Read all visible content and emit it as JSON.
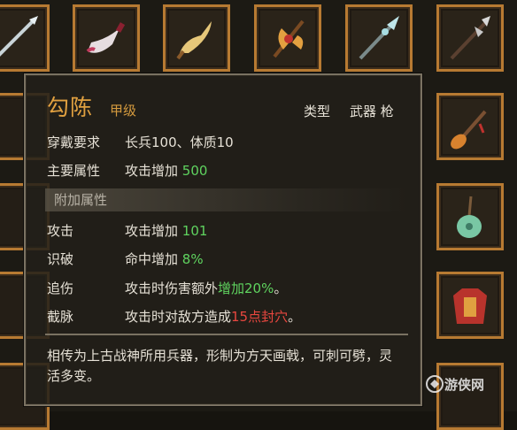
{
  "item": {
    "name": "勾陈",
    "grade": "甲级",
    "type_label": "类型",
    "type_value": "武器 枪",
    "requirement_label": "穿戴要求",
    "requirement_value": "长兵100、体质10",
    "main_attr_label": "主要属性",
    "main_attr_text": "攻击增加",
    "main_attr_value": "500",
    "extra_section_title": "附加属性",
    "extra_attrs": [
      {
        "label": "攻击",
        "text": "攻击增加",
        "value": "101"
      },
      {
        "label": "识破",
        "text": "命中增加",
        "value": "8%"
      },
      {
        "label": "追伤",
        "text_before": "攻击时伤害额外",
        "highlight": "增加20%",
        "text_after": "。"
      },
      {
        "label": "截脉",
        "text_before": "攻击时对敌方造成",
        "highlight": "15点封穴",
        "text_after": "。"
      }
    ],
    "description": "相传为上古战神所用兵器，形制为方天画戟，可刺可劈，灵活多变。"
  },
  "watermark": "游侠网",
  "colors": {
    "slot_border": "#b77a32",
    "name": "#e0a040",
    "bonus_green": "#5fd35f",
    "bonus_red": "#e8473f"
  }
}
